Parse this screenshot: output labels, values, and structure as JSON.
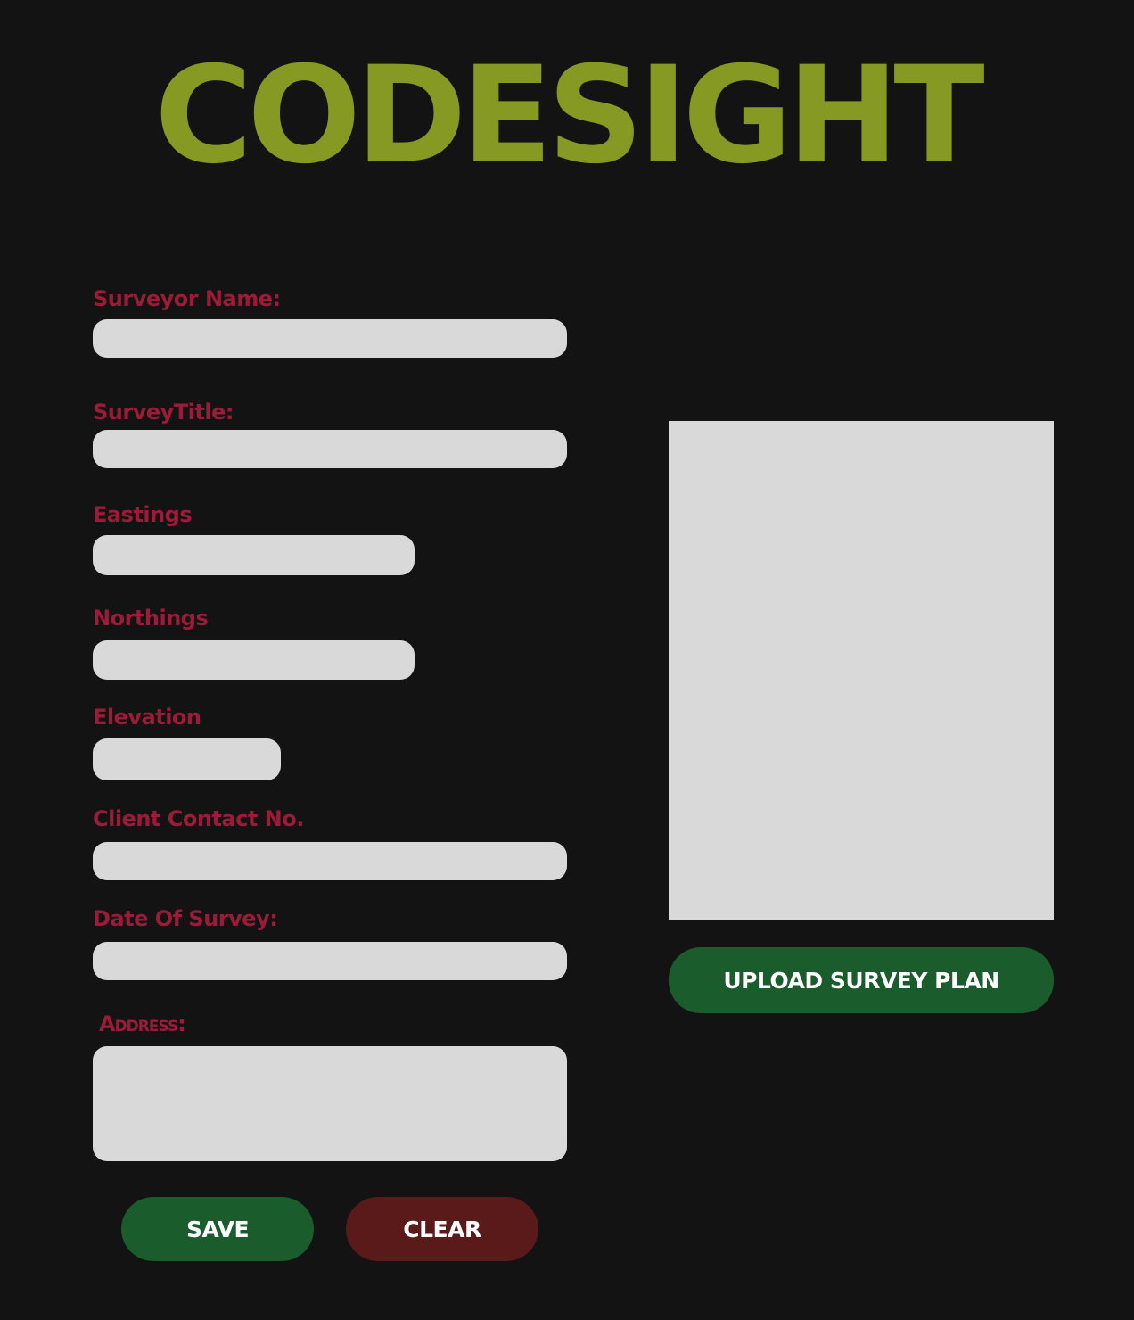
{
  "header": {
    "title": "CODESIGHT"
  },
  "form": {
    "surveyor_name_label": "Surveyor Name:",
    "survey_title_label": "SurveyTitle:",
    "eastings_label": "Eastings",
    "northings_label": "Northings",
    "elevation_label": "Elevation",
    "client_contact_label": "Client Contact No.",
    "date_of_survey_label": "Date Of Survey:",
    "address_label": "Address:"
  },
  "actions": {
    "upload_label": "UPLOAD SURVEY PLAN",
    "save_label": "SAVE",
    "clear_label": "CLEAR"
  },
  "colors": {
    "background": "#131313",
    "title": "#869922",
    "label": "#9c1b38",
    "field": "#d9d9d9",
    "primary_button": "#1a5c2c",
    "danger_button": "#5b1a1a"
  }
}
